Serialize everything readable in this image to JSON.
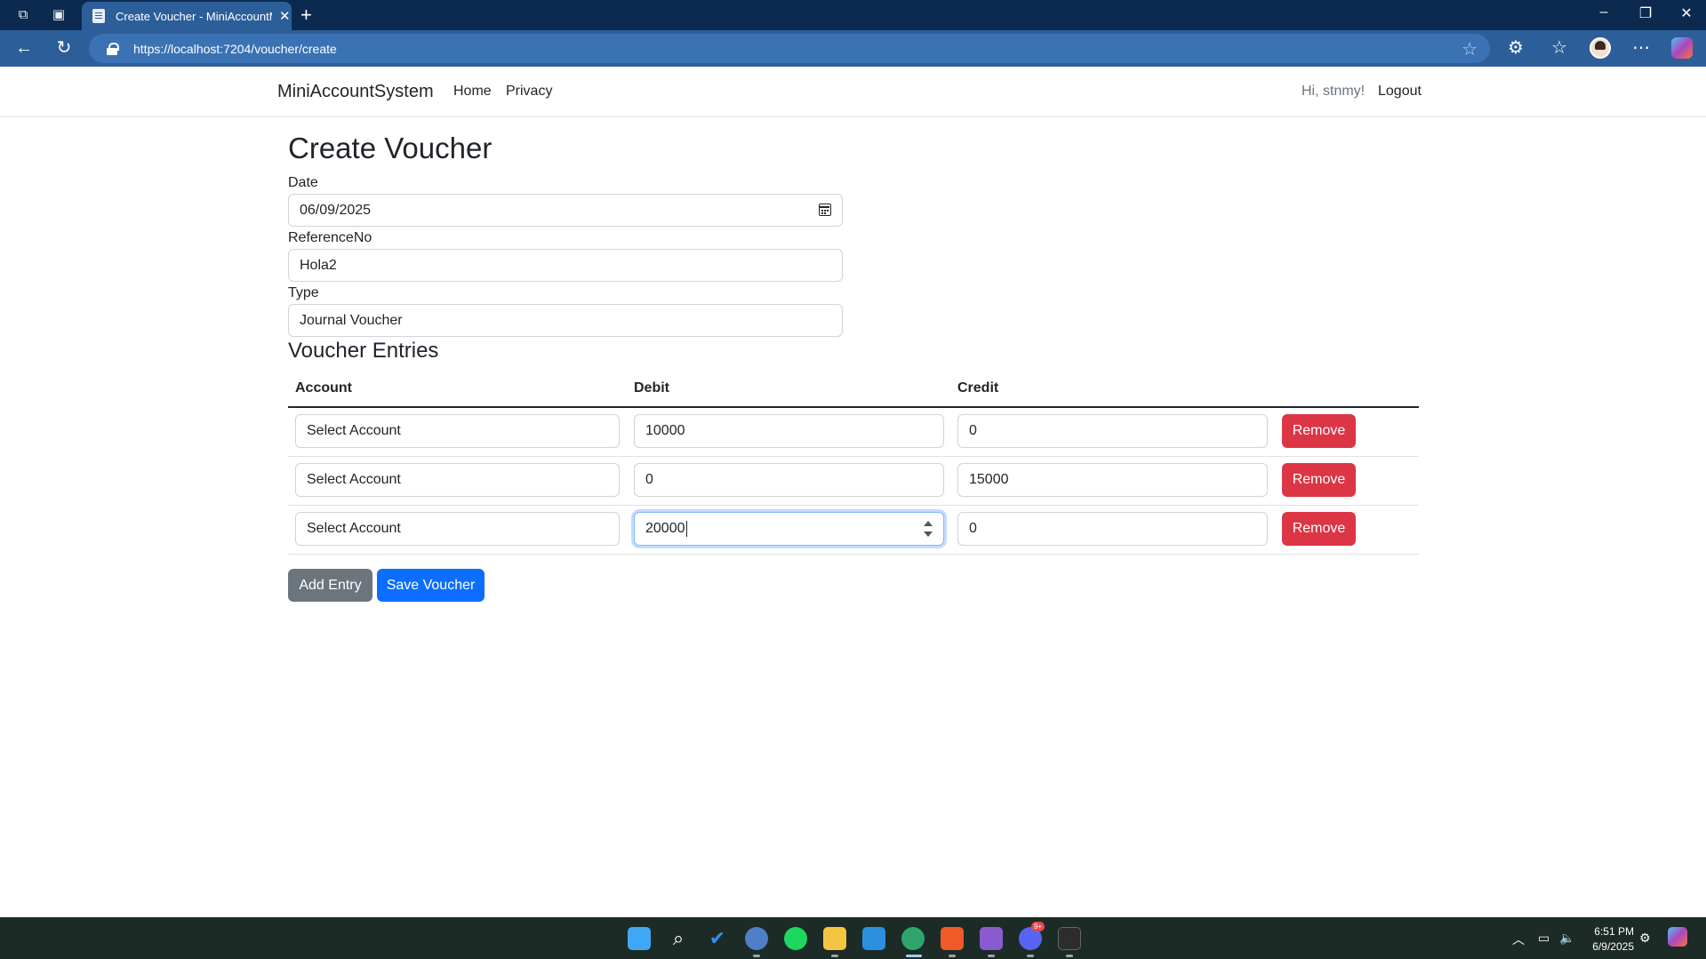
{
  "browser": {
    "tab_title": "Create Voucher - MiniAccountMa",
    "url": "https://localhost:7204/voucher/create"
  },
  "site": {
    "brand": "MiniAccountSystem",
    "nav": [
      "Home",
      "Privacy"
    ],
    "greeting": "Hi, stnmy!",
    "logout": "Logout"
  },
  "form": {
    "title": "Create Voucher",
    "date_label": "Date",
    "date_value": "06/09/2025",
    "reference_label": "ReferenceNo",
    "reference_value": "Hola2",
    "type_label": "Type",
    "type_value": "Journal Voucher"
  },
  "entries": {
    "title": "Voucher Entries",
    "headers": [
      "Account",
      "Debit",
      "Credit"
    ],
    "rows": [
      {
        "account": "Select Account",
        "debit": "10000",
        "credit": "0",
        "remove": "Remove"
      },
      {
        "account": "Select Account",
        "debit": "0",
        "credit": "15000",
        "remove": "Remove"
      },
      {
        "account": "Select Account",
        "debit": "20000",
        "credit": "0",
        "remove": "Remove"
      }
    ]
  },
  "actions": {
    "add_entry": "Add Entry",
    "save_voucher": "Save Voucher"
  },
  "taskbar": {
    "time": "6:51 PM",
    "date": "6/9/2025",
    "discord_badge": "9+"
  },
  "colors": {
    "titlebar": "#0c2a4f",
    "browser_toolbar": "#2c5f9a",
    "danger": "#dc3545",
    "primary": "#0d6efd",
    "secondary": "#6c757d",
    "taskbar": "#1c2b26"
  },
  "icons": {
    "tab_actions": "tab-actions-icon",
    "tab_favicon": "page-icon",
    "address_lock": "lock-icon",
    "favorite": "star-icon",
    "date_picker": "calendar-icon"
  }
}
